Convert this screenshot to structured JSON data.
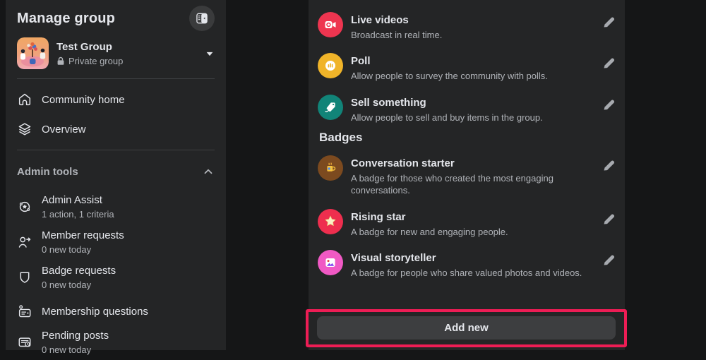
{
  "sidebar": {
    "title": "Manage group",
    "toggle_icon": "sidebar-collapse-icon",
    "group": {
      "name": "Test Group",
      "privacy": "Private group",
      "privacy_icon": "lock-icon",
      "avatar": "group-avatar-illustration"
    },
    "nav": [
      {
        "label": "Community home",
        "icon": "home-icon"
      },
      {
        "label": "Overview",
        "icon": "layers-icon"
      }
    ],
    "admin_tools": {
      "header": "Admin tools",
      "collapse_icon": "chevron-up-icon",
      "items": [
        {
          "label": "Admin Assist",
          "sub": "1 action, 1 criteria",
          "icon": "admin-assist-seal-icon"
        },
        {
          "label": "Member requests",
          "sub": "0 new today",
          "icon": "person-arrow-icon"
        },
        {
          "label": "Badge requests",
          "sub": "0 new today",
          "icon": "shield-icon"
        },
        {
          "label": "Membership questions",
          "icon": "person-card-icon"
        },
        {
          "label": "Pending posts",
          "sub": "0 new today",
          "icon": "post-clock-icon"
        }
      ]
    }
  },
  "panel": {
    "features": [
      {
        "title": "Live videos",
        "desc": "Broadcast in real time.",
        "icon": "live-video-icon",
        "icon_color": "#EE3550"
      },
      {
        "title": "Poll",
        "desc": "Allow people to survey the community with polls.",
        "icon": "poll-bars-icon",
        "icon_color": "#F0B429"
      },
      {
        "title": "Sell something",
        "desc": "Allow people to sell and buy items in the group.",
        "icon": "price-tag-icon",
        "icon_color": "#118478"
      }
    ],
    "badges_header": "Badges",
    "badges": [
      {
        "title": "Conversation starter",
        "desc": "A badge for those who created the most engaging conversations.",
        "icon": "coffee-mug-badge-icon",
        "icon_color": "#7C4A1F"
      },
      {
        "title": "Rising star",
        "desc": "A badge for new and engaging people.",
        "icon": "star-badge-icon",
        "icon_color": "#EE2E4E"
      },
      {
        "title": "Visual storyteller",
        "desc": "A badge for people who share valued photos and videos.",
        "icon": "photo-badge-icon",
        "icon_color": "#F059C4"
      }
    ],
    "edit_icon": "pencil-icon",
    "add_new_label": "Add new"
  },
  "colors": {
    "page_bg": "#151617",
    "surface_bg": "#242526",
    "divider": "#3E4042",
    "text_primary": "#E4E6EB",
    "text_secondary": "#B0B3B8",
    "button_bg": "#3D3E40",
    "annotation_highlight": "#ED1D55"
  }
}
